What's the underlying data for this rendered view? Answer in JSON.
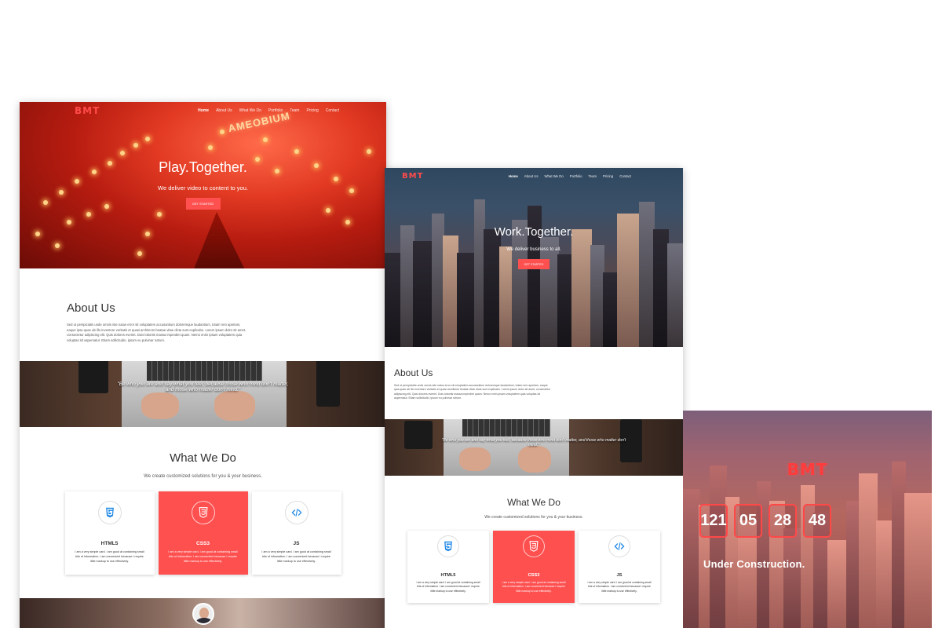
{
  "brand": {
    "logo": "BMT",
    "accent": "#ff5050"
  },
  "nav": {
    "items": [
      "Home",
      "About Us",
      "What We Do",
      "Portfolio",
      "Team",
      "Pricing",
      "Contact"
    ]
  },
  "mockup_large": {
    "hero": {
      "title": "Play.Together.",
      "subtitle": "We deliver video to content to you.",
      "cta": "GET STARTED",
      "sign": "AMEOBIUM"
    },
    "about": {
      "title": "About Us",
      "body": "Sed ut perspiciatis unde omnis iste natus error sit voluptatem accusantium doloremque laudantium, totam rem aperiam, eaque ipsa quae ab illo inventore veritatis et quasi architecto beatae vitae dicta sunt explicabo. Lorem ipsum dolor sit amet, consectetur adipiscing elit. Quis dolores everiet. Duis lobortis massa imperdiet quam. Nemo enim ipsam voluptatem quia voluptas sit aspernatur. Etiam sollicitudin, ipsum eu pulvinar rutrum."
    },
    "quote": "\"Be who you are and say what you feel, because those who mind don't matter, and those who matter don't mind.\"",
    "services": {
      "title": "What We Do",
      "subtitle": "We create customized solutions for you & your business.",
      "cards": [
        {
          "name": "HTML5",
          "icon": "html5-icon",
          "text": "I am a very simple card. I am good at containing small bits of information. I am convenient because I require little markup to use effectively."
        },
        {
          "name": "CSS3",
          "icon": "css3-icon",
          "text": "I am a very simple card. I am good at containing small bits of information. I am convenient because I require little markup to use effectively."
        },
        {
          "name": "JS",
          "icon": "code-icon",
          "text": "I am a very simple card. I am good at containing small bits of information. I am convenient because I require little markup to use effectively."
        }
      ]
    }
  },
  "mockup_medium": {
    "hero": {
      "title": "Work.Together.",
      "subtitle": "We deliver business to all.",
      "cta": "GET STARTED"
    },
    "about": {
      "title": "About Us",
      "body": "Sed ut perspiciatis unde omnis iste natus error sit voluptatem accusantium doloremque laudantium, totam rem aperiam, eaque ipsa quae ab illo inventore veritatis et quasi architecto beatae vitae dicta sunt explicabo. Lorem ipsum dolor sit amet, consectetur adipiscing elit. Quis dolores everiet. Duis lobortis massa imperdiet quam. Nemo enim ipsam voluptatem quia voluptas sit aspernatur. Etiam sollicitudin, ipsum eu pulvinar rutrum."
    },
    "quote": "\"Be who you are and say what you feel, because those who mind don't matter, and those who matter don't mind.\"",
    "services": {
      "title": "What We Do",
      "subtitle": "We create customized solutions for you & your business.",
      "cards": [
        {
          "name": "HTML5",
          "icon": "html5-icon",
          "text": "I am a very simple card. I am good at containing small bits of information. I am convenient because I require little markup to use effectively."
        },
        {
          "name": "CSS3",
          "icon": "css3-icon",
          "text": "I am a very simple card. I am good at containing small bits of information. I am convenient because I require little markup to use effectively."
        },
        {
          "name": "JS",
          "icon": "code-icon",
          "text": "I am a very simple card. I am good at containing small bits of information. I am convenient because I require little markup to use effectively."
        }
      ]
    }
  },
  "mockup_small": {
    "countdown": [
      "121",
      "05",
      "28",
      "48"
    ],
    "status": "Under Construction."
  }
}
